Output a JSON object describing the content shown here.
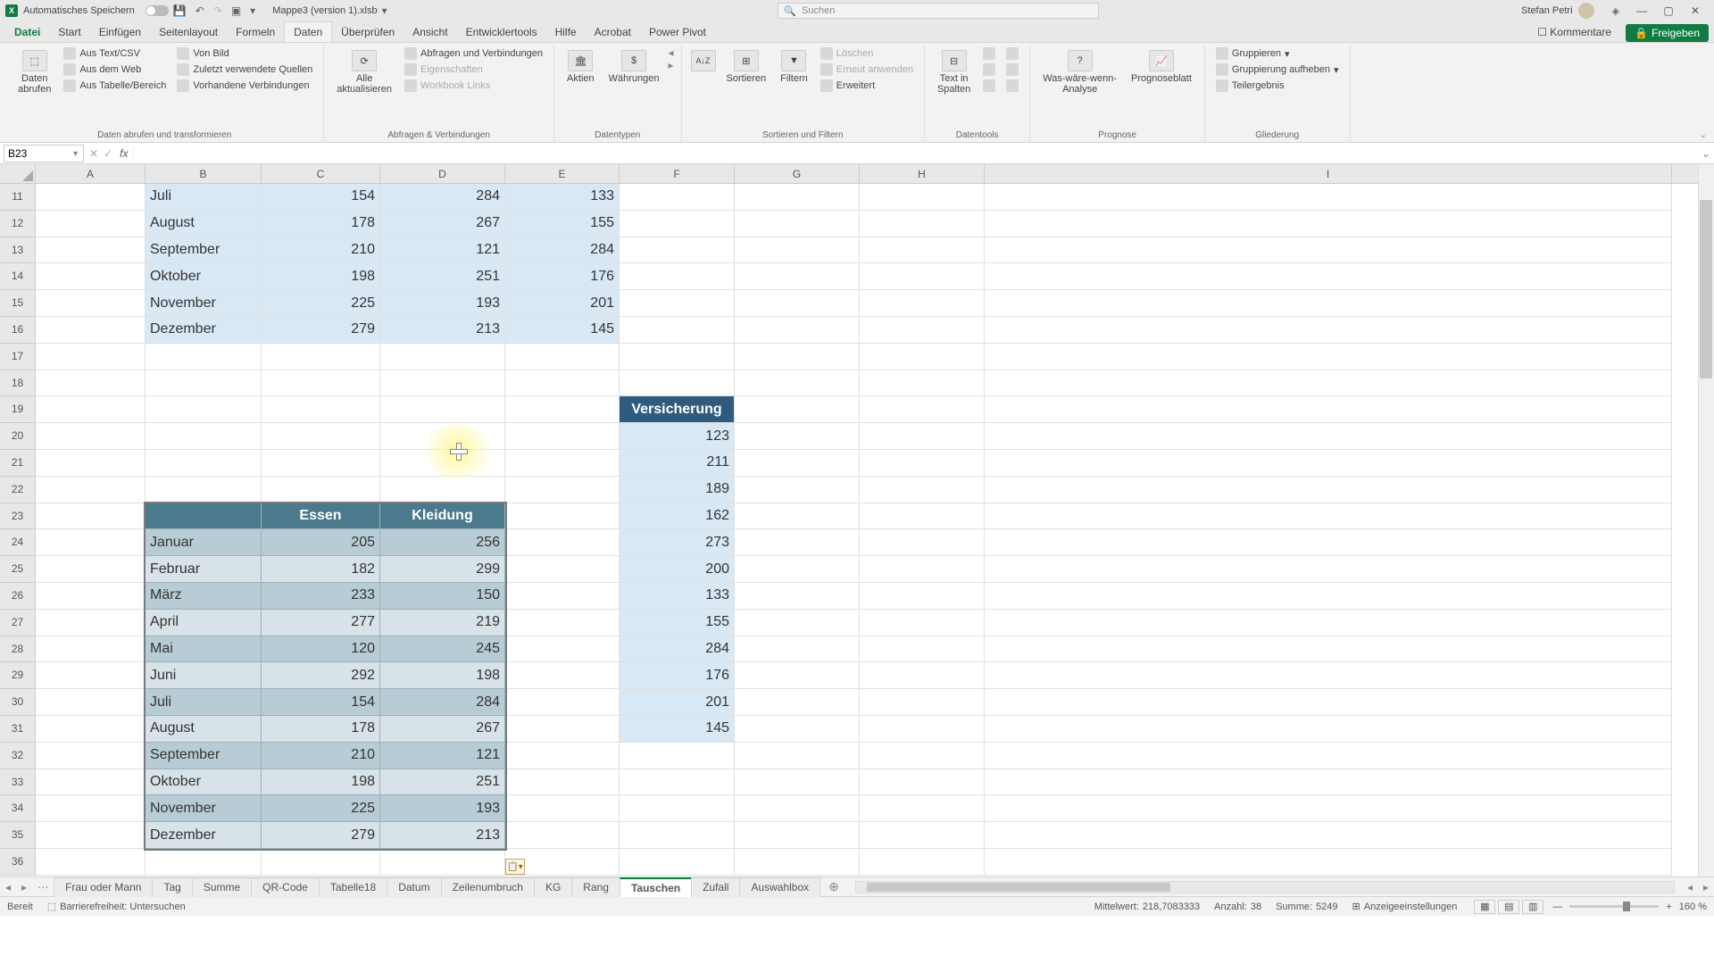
{
  "titlebar": {
    "autosave_label": "Automatisches Speichern",
    "doc_name": "Mappe3 (version 1).xlsb",
    "search_placeholder": "Suchen",
    "user_name": "Stefan Petri"
  },
  "tabs": {
    "file": "Datei",
    "start": "Start",
    "einf": "Einfügen",
    "layout": "Seitenlayout",
    "formeln": "Formeln",
    "daten": "Daten",
    "ueber": "Überprüfen",
    "ansicht": "Ansicht",
    "dev": "Entwicklertools",
    "hilfe": "Hilfe",
    "acrobat": "Acrobat",
    "pp": "Power Pivot",
    "comments": "Kommentare",
    "share": "Freigeben"
  },
  "ribbon": {
    "daten_abrufen": "Daten\nabrufen",
    "aus_text": "Aus Text/CSV",
    "von_bild": "Von Bild",
    "aus_web": "Aus dem Web",
    "zuletzt": "Zuletzt verwendete Quellen",
    "aus_tabelle": "Aus Tabelle/Bereich",
    "vorhandene": "Vorhandene Verbindungen",
    "grp1": "Daten abrufen und transformieren",
    "alle_akt": "Alle\naktualisieren",
    "abfr_verb": "Abfragen und Verbindungen",
    "eigensch": "Eigenschaften",
    "wb_links": "Workbook Links",
    "grp2": "Abfragen & Verbindungen",
    "aktien": "Aktien",
    "waehr": "Währungen",
    "grp3": "Datentypen",
    "sortieren": "Sortieren",
    "filtern": "Filtern",
    "loeschen": "Löschen",
    "erneut": "Erneut anwenden",
    "erweitert": "Erweitert",
    "grp4": "Sortieren und Filtern",
    "text_sp": "Text in\nSpalten",
    "grp5": "Datentools",
    "waswenn": "Was-wäre-wenn-\nAnalyse",
    "progn": "Prognoseblatt",
    "grp6": "Prognose",
    "grupp": "Gruppieren",
    "grupp_auf": "Gruppierung aufheben",
    "teilerg": "Teilergebnis",
    "grp7": "Gliederung"
  },
  "namebox": "B23",
  "cols": {
    "A": "A",
    "B": "B",
    "C": "C",
    "D": "D",
    "E": "E",
    "F": "F",
    "G": "G",
    "H": "H",
    "I": "I"
  },
  "rows_start": 11,
  "table1": [
    {
      "m": "Juli",
      "c": 154,
      "d": 284,
      "e": 133
    },
    {
      "m": "August",
      "c": 178,
      "d": 267,
      "e": 155
    },
    {
      "m": "September",
      "c": 210,
      "d": 121,
      "e": 284
    },
    {
      "m": "Oktober",
      "c": 198,
      "d": 251,
      "e": 176
    },
    {
      "m": "November",
      "c": 225,
      "d": 193,
      "e": 201
    },
    {
      "m": "Dezember",
      "c": 279,
      "d": 213,
      "e": 145
    }
  ],
  "versich_hdr": "Versicherung",
  "versich": [
    123,
    211,
    189,
    162,
    273,
    200,
    133,
    155,
    284,
    176,
    201,
    145
  ],
  "table2_hdr": {
    "b": "",
    "c": "Essen",
    "d": "Kleidung"
  },
  "table2": [
    {
      "m": "Januar",
      "c": 205,
      "d": 256
    },
    {
      "m": "Februar",
      "c": 182,
      "d": 299
    },
    {
      "m": "März",
      "c": 233,
      "d": 150
    },
    {
      "m": "April",
      "c": 277,
      "d": 219
    },
    {
      "m": "Mai",
      "c": 120,
      "d": 245
    },
    {
      "m": "Juni",
      "c": 292,
      "d": 198
    },
    {
      "m": "Juli",
      "c": 154,
      "d": 284
    },
    {
      "m": "August",
      "c": 178,
      "d": 267
    },
    {
      "m": "September",
      "c": 210,
      "d": 121
    },
    {
      "m": "Oktober",
      "c": 198,
      "d": 251
    },
    {
      "m": "November",
      "c": 225,
      "d": 193
    },
    {
      "m": "Dezember",
      "c": 279,
      "d": 213
    }
  ],
  "sheets": [
    "Frau oder Mann",
    "Tag",
    "Summe",
    "QR-Code",
    "Tabelle18",
    "Datum",
    "Zeilenumbruch",
    "KG",
    "Rang",
    "Tauschen",
    "Zufall",
    "Auswahlbox"
  ],
  "sheet_active": "Tauschen",
  "status": {
    "bereit": "Bereit",
    "barrier": "Barrierefreiheit: Untersuchen",
    "mittel_l": "Mittelwert:",
    "mittel_v": "218,7083333",
    "anz_l": "Anzahl:",
    "anz_v": "38",
    "sum_l": "Summe:",
    "sum_v": "5249",
    "anzeige": "Anzeigeeinstellungen",
    "zoom": "160 %"
  }
}
